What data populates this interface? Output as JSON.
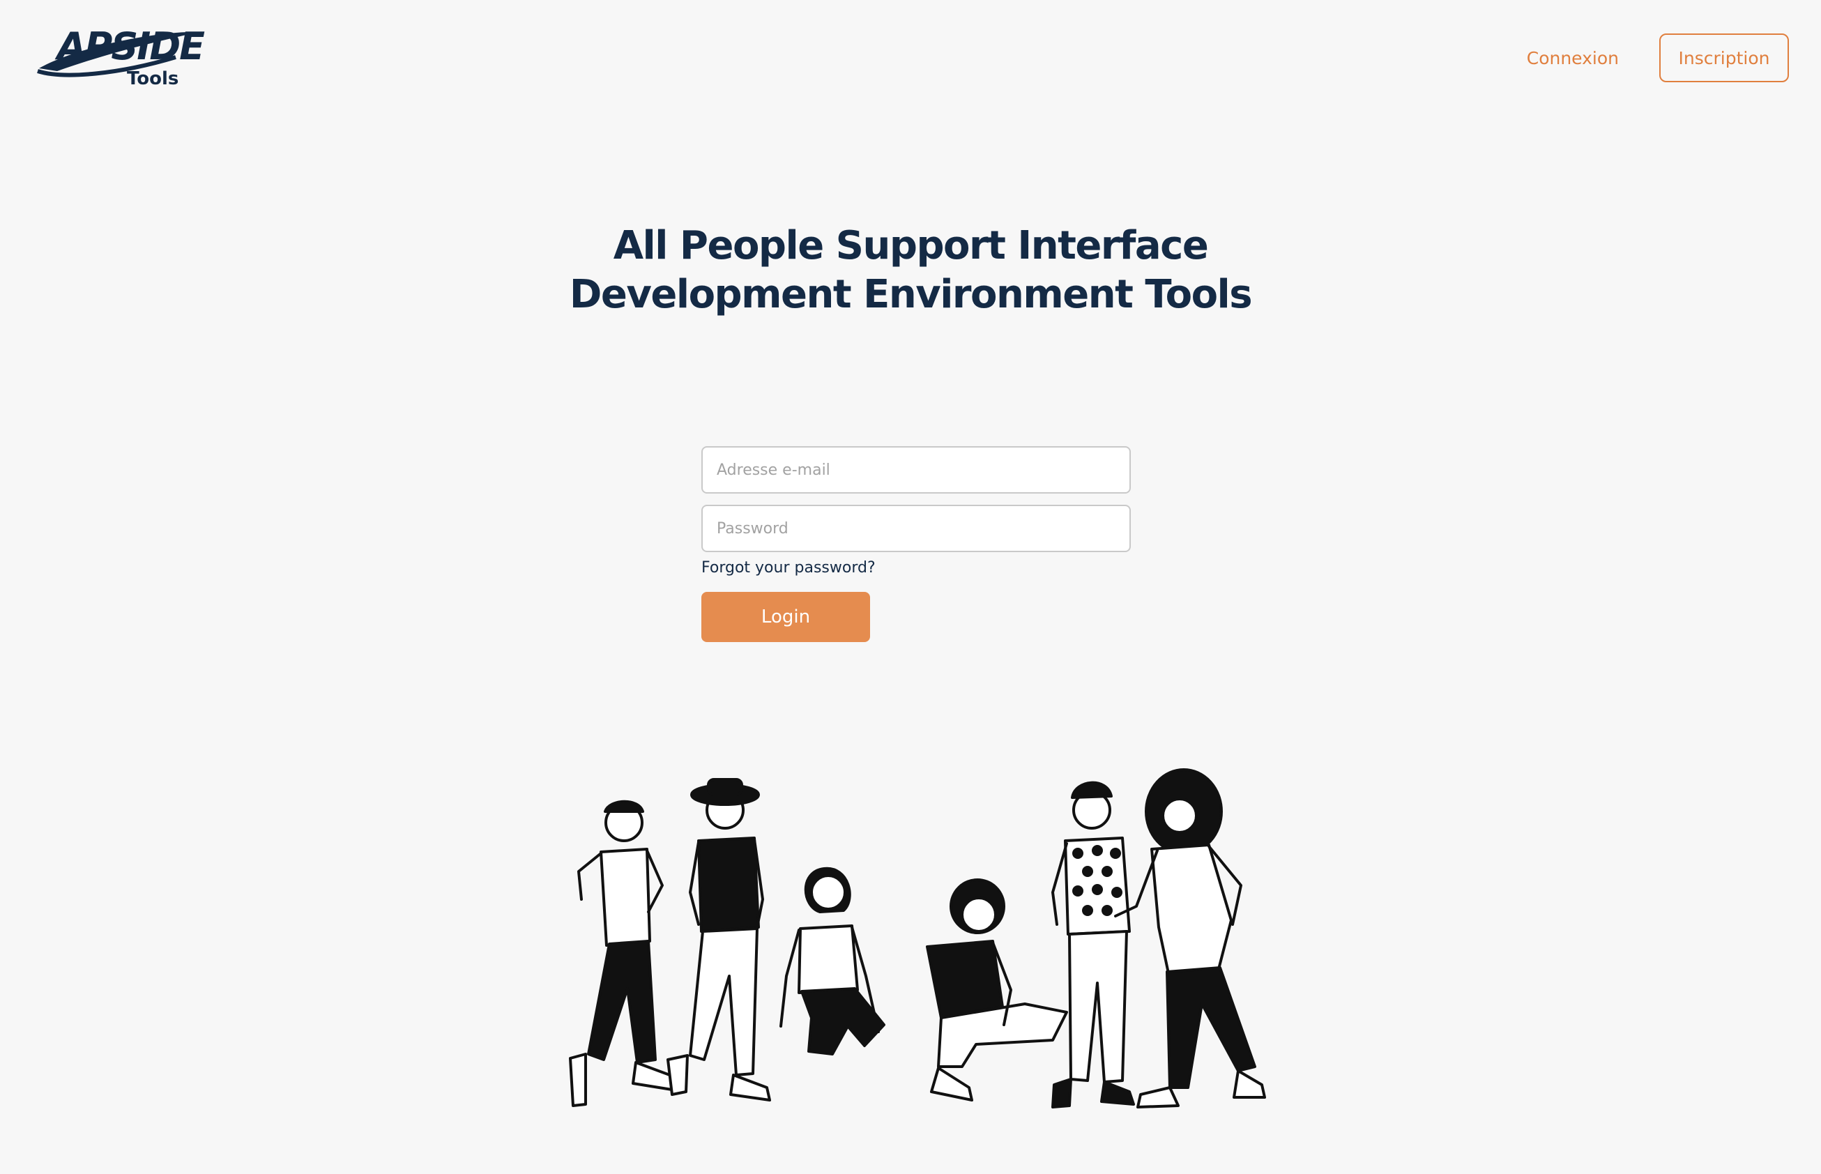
{
  "header": {
    "logo_text": "APSIDE",
    "logo_subtext": "Tools",
    "nav": {
      "connexion_label": "Connexion",
      "inscription_label": "Inscription"
    }
  },
  "hero": {
    "title_line1": "All People Support Interface",
    "title_line2": "Development Environment Tools"
  },
  "login_form": {
    "email_placeholder": "Adresse e-mail",
    "email_value": "",
    "password_placeholder": "Password",
    "password_value": "",
    "forgot_label": "Forgot your password?",
    "login_label": "Login"
  },
  "illustration": {
    "icon": "people-group-illustration"
  },
  "colors": {
    "accent": "#e07f3e",
    "button": "#e58c4f",
    "navy": "#142a45",
    "background": "#f7f7f7"
  }
}
